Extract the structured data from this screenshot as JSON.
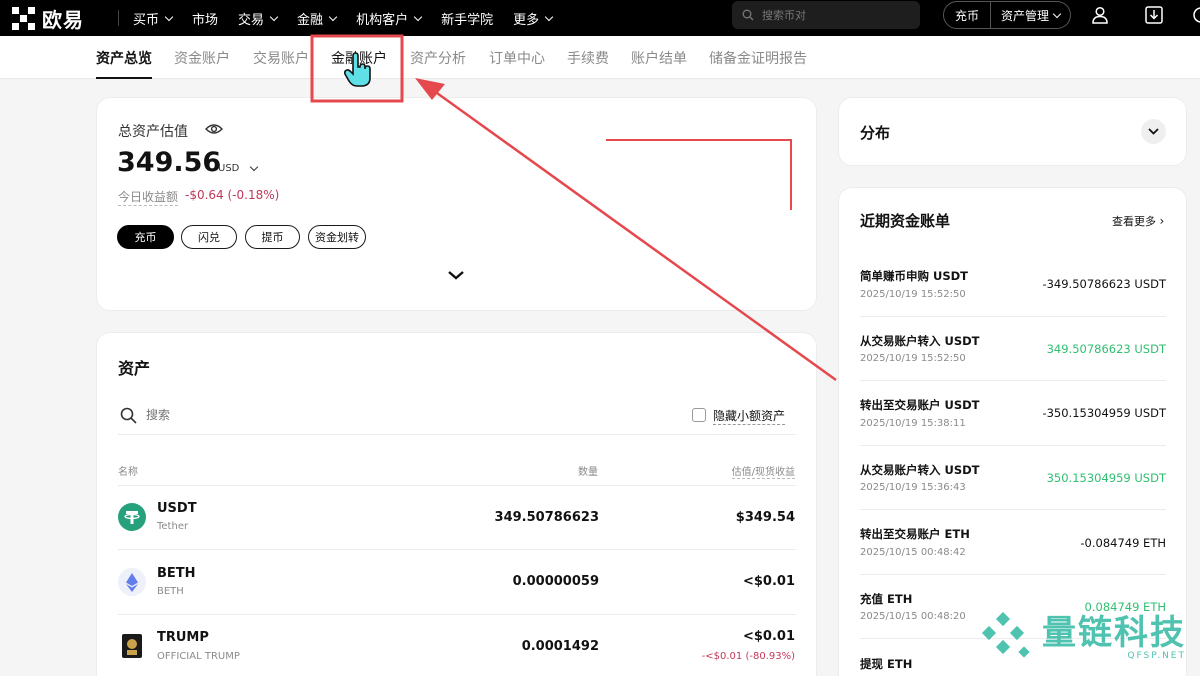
{
  "brand": {
    "name": "欧易"
  },
  "nav": {
    "items": [
      {
        "label": "买币",
        "dropdown": true
      },
      {
        "label": "市场",
        "dropdown": false
      },
      {
        "label": "交易",
        "dropdown": true
      },
      {
        "label": "金融",
        "dropdown": true
      },
      {
        "label": "机构客户",
        "dropdown": true
      },
      {
        "label": "新手学院",
        "dropdown": false
      },
      {
        "label": "更多",
        "dropdown": true
      }
    ],
    "search_placeholder": "搜索币对",
    "deposit_label": "充币",
    "asset_mgmt_label": "资产管理"
  },
  "subtabs": [
    "资产总览",
    "资金账户",
    "交易账户",
    "金融账户",
    "资产分析",
    "订单中心",
    "手续费",
    "账户结单",
    "储备金证明报告"
  ],
  "overview": {
    "title": "总资产估值",
    "amount": "349.56",
    "currency": "USD",
    "pnl_label": "今日收益额",
    "pnl_value": "-$0.64 (-0.18%)",
    "buttons": [
      "充币",
      "闪兑",
      "提币",
      "资金划转"
    ]
  },
  "assets": {
    "title": "资产",
    "search_placeholder": "搜索",
    "hide_small_label": "隐藏小额资产",
    "columns": {
      "name": "名称",
      "qty": "数量",
      "value": "估值/现货收益"
    },
    "rows": [
      {
        "symbol": "USDT",
        "name": "Tether",
        "qty": "349.50786623",
        "value": "$349.54",
        "pnl": ""
      },
      {
        "symbol": "BETH",
        "name": "BETH",
        "qty": "0.00000059",
        "value": "<$0.01",
        "pnl": ""
      },
      {
        "symbol": "TRUMP",
        "name": "OFFICIAL TRUMP",
        "qty": "0.0001492",
        "value": "<$0.01",
        "pnl": "-<$0.01 (-80.93%)"
      }
    ]
  },
  "distribution": {
    "title": "分布"
  },
  "bills": {
    "title": "近期资金账单",
    "more_label": "查看更多",
    "items": [
      {
        "title": "简单赚币申购 USDT",
        "time": "2025/10/19 15:52:50",
        "amount": "-349.50786623 USDT",
        "positive": false
      },
      {
        "title": "从交易账户转入 USDT",
        "time": "2025/10/19 15:52:50",
        "amount": "349.50786623 USDT",
        "positive": true
      },
      {
        "title": "转出至交易账户 USDT",
        "time": "2025/10/19 15:38:11",
        "amount": "-350.15304959 USDT",
        "positive": false
      },
      {
        "title": "从交易账户转入 USDT",
        "time": "2025/10/19 15:36:43",
        "amount": "350.15304959 USDT",
        "positive": true
      },
      {
        "title": "转出至交易账户 ETH",
        "time": "2025/10/15 00:48:42",
        "amount": "-0.084749 ETH",
        "positive": false
      },
      {
        "title": "充值 ETH",
        "time": "2025/10/15 00:48:20",
        "amount": "0.084749 ETH",
        "positive": true
      },
      {
        "title": "提现 ETH",
        "time": "",
        "amount": "",
        "positive": false
      }
    ]
  },
  "watermark": {
    "text": "量链科技",
    "sub": "QFSP.NET"
  },
  "colors": {
    "annotation_red": "#e5484d",
    "positive": "#2fbf71",
    "negative": "#c0395b",
    "usdt": "#26a17b"
  }
}
